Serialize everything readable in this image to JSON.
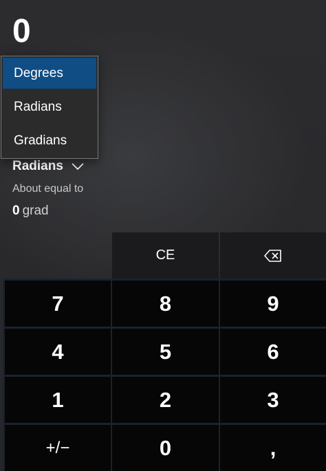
{
  "display": {
    "value": "0"
  },
  "unit_dropdown": {
    "options": [
      {
        "label": "Degrees",
        "selected": true
      },
      {
        "label": "Radians",
        "selected": false
      },
      {
        "label": "Gradians",
        "selected": false
      }
    ],
    "selected_label": "Radians",
    "chevron_icon": "chevron-down-icon"
  },
  "result": {
    "about_label": "About equal to",
    "value": "0",
    "unit": "grad"
  },
  "keypad": {
    "clear_entry_label": "CE",
    "backspace_icon": "backspace-icon",
    "rows": [
      [
        "7",
        "8",
        "9"
      ],
      [
        "4",
        "5",
        "6"
      ],
      [
        "1",
        "2",
        "3"
      ],
      [
        "+/−",
        "0",
        ","
      ]
    ]
  },
  "colors": {
    "selected_item": "#0f4d84",
    "number_key": "#060606",
    "function_key": "#1b1b1d",
    "background": "#2a2a2d"
  }
}
